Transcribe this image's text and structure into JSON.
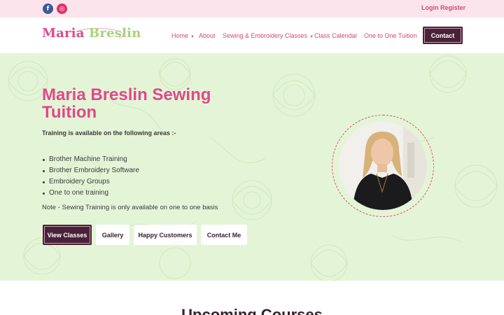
{
  "topbar": {
    "social": [
      {
        "icon": "facebook-icon",
        "glyph": "f",
        "color": "#3b5998"
      },
      {
        "icon": "instagram-icon",
        "glyph": "◎",
        "color": "#e1306c"
      }
    ],
    "login": "Login",
    "register": "Register"
  },
  "header": {
    "logo_first": "Maria",
    "logo_second": "Breslin",
    "nav": [
      {
        "label": "Home",
        "has_dropdown": true
      },
      {
        "label": "About",
        "has_dropdown": false
      },
      {
        "label": "Sewing & Embroidery Classes",
        "has_dropdown": true
      },
      {
        "label": "Class Calendar",
        "has_dropdown": false
      },
      {
        "label": "One to One Tuition",
        "has_dropdown": false
      }
    ],
    "contact": "Contact"
  },
  "hero": {
    "title": "Maria Breslin Sewing Tuition",
    "subtitle": "Training is available on the following areas :-",
    "items": [
      "Brother Machine Training",
      "Brother Embroidery Software",
      "Embroidery Groups",
      "One to one training"
    ],
    "note": "Note - Sewing Training is only available on one to one basis",
    "buttons": [
      "View Classes",
      "Gallery",
      "Happy Customers",
      "Contact Me"
    ]
  },
  "section": {
    "title": "Upcoming Courses"
  },
  "colors": {
    "accent_pink": "#e0498a",
    "logo_green": "#a9d27d",
    "dark_plum": "#4a2238",
    "hero_bg": "#e4f5d7",
    "topbar_bg": "#fce4ec"
  }
}
